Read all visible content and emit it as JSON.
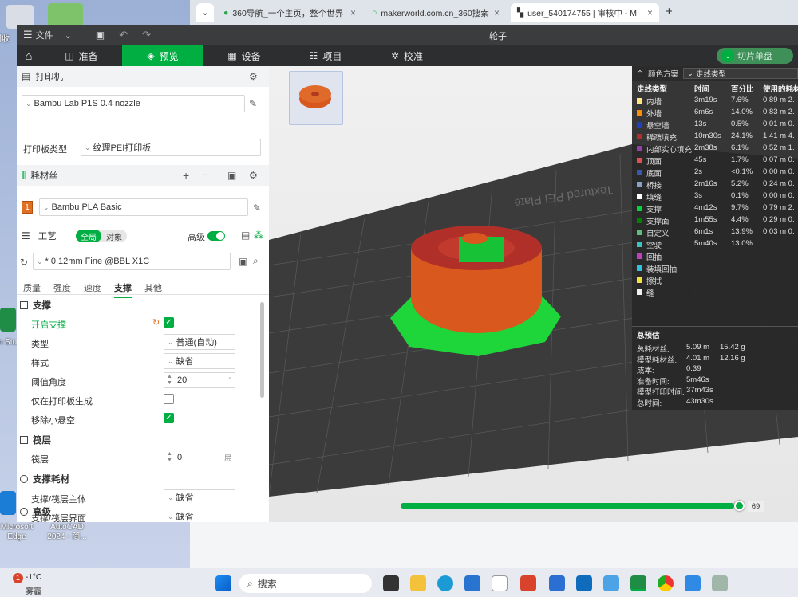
{
  "colors": {
    "accent": "#00ae42",
    "titlebar": "#3a3c3d",
    "tabbar": "#2c2e2f"
  },
  "desktop": {
    "icons": [
      {
        "label": "回收",
        "name": "recycle-bin-icon"
      },
      {
        "label": "Bam Stu",
        "name": "bambu-studio-icon"
      },
      {
        "label": "Microsoft Edge",
        "name": "edge-icon"
      },
      {
        "label": "AutoCAD 2024 - 简...",
        "name": "autocad-icon"
      }
    ]
  },
  "browser": {
    "tabs": [
      {
        "label": "360导航_一个主页，整个世界"
      },
      {
        "label": "makerworld.com.cn_360搜索"
      },
      {
        "label": "user_540174755 | 审核中 - M"
      }
    ],
    "new_tab": "+"
  },
  "app": {
    "menu_label": "文件",
    "window_title": "轮子",
    "tabs": [
      {
        "label": "准备"
      },
      {
        "label": "预览"
      },
      {
        "label": "设备"
      },
      {
        "label": "项目"
      },
      {
        "label": "校准"
      }
    ],
    "slice_button": "切片单盘"
  },
  "panel": {
    "printer": {
      "title": "打印机",
      "printer_name": "Bambu Lab P1S 0.4 nozzle",
      "plate_label": "打印板类型",
      "plate_value": "纹理PEI打印板"
    },
    "filament": {
      "title": "耗材丝",
      "index": "1",
      "name": "Bambu PLA Basic"
    },
    "process": {
      "title": "工艺",
      "scope_global": "全局",
      "scope_object": "对象",
      "advanced_label": "高级",
      "preset": "* 0.12mm Fine @BBL X1C",
      "sub_tabs": [
        "质量",
        "强度",
        "速度",
        "支撑",
        "其他"
      ]
    },
    "support": {
      "title": "支撑",
      "enable_label": "开启支撑",
      "enable_checked": true,
      "type_label": "类型",
      "type_value": "普通(自动)",
      "style_label": "样式",
      "style_value": "缺省",
      "threshold_label": "阈值角度",
      "threshold_value": "20",
      "threshold_unit": "°",
      "only_plate_label": "仅在打印板生成",
      "only_plate_checked": false,
      "remove_small_label": "移除小悬空",
      "remove_small_checked": true
    },
    "raft": {
      "title": "筏层",
      "layers_label": "筏层",
      "layers_value": "0",
      "layers_unit": "层"
    },
    "support_filament": {
      "title": "支撑耗材",
      "base_label": "支撑/筏层主体",
      "base_value": "缺省",
      "interface_label": "支撑/筏层界面",
      "interface_value": "缺省"
    },
    "advanced": {
      "title": "高级"
    }
  },
  "viewport": {
    "plate_text": "Textured PEI Plate"
  },
  "legend": {
    "title": "颜色方案",
    "scheme": "走线类型",
    "columns": [
      "走线类型",
      "时间",
      "百分比",
      "使用的耗材"
    ],
    "rows": [
      {
        "name": "内墙",
        "time": "3m19s",
        "pct": "7.6%",
        "usage": "0.89 m 2.",
        "color": "#ffe680"
      },
      {
        "name": "外墙",
        "time": "6m6s",
        "pct": "14.0%",
        "usage": "0.83 m 2.",
        "color": "#ff8c00"
      },
      {
        "name": "悬空墙",
        "time": "13s",
        "pct": "0.5%",
        "usage": "0.01 m 0.",
        "color": "#1f3fbf"
      },
      {
        "name": "稀疏填充",
        "time": "10m30s",
        "pct": "24.1%",
        "usage": "1.41 m 4.",
        "color": "#b03029"
      },
      {
        "name": "内部实心填充",
        "time": "2m38s",
        "pct": "6.1%",
        "usage": "0.52 m 1.",
        "color": "#9440a8"
      },
      {
        "name": "顶面",
        "time": "45s",
        "pct": "1.7%",
        "usage": "0.07 m 0.",
        "color": "#e05050"
      },
      {
        "name": "底面",
        "time": "2s",
        "pct": "<0.1%",
        "usage": "0.00 m 0.",
        "color": "#3858b0"
      },
      {
        "name": "桥接",
        "time": "2m16s",
        "pct": "5.2%",
        "usage": "0.24 m 0.",
        "color": "#8aa0c8"
      },
      {
        "name": "填缝",
        "time": "3s",
        "pct": "0.1%",
        "usage": "0.00 m 0.",
        "color": "#ffffff"
      },
      {
        "name": "支撑",
        "time": "4m12s",
        "pct": "9.7%",
        "usage": "0.79 m 2.",
        "color": "#00d43a"
      },
      {
        "name": "支撑面",
        "time": "1m55s",
        "pct": "4.4%",
        "usage": "0.29 m 0.",
        "color": "#008000"
      },
      {
        "name": "自定义",
        "time": "6m1s",
        "pct": "13.9%",
        "usage": "0.03 m 0.",
        "color": "#5ebd78"
      },
      {
        "name": "空驶",
        "time": "5m40s",
        "pct": "13.0%",
        "usage": "",
        "color": "#40c0c0"
      },
      {
        "name": "回抽",
        "time": "",
        "pct": "",
        "usage": "",
        "color": "#c040c0"
      },
      {
        "name": "装填回抽",
        "time": "",
        "pct": "",
        "usage": "",
        "color": "#30c0e0"
      },
      {
        "name": "擦拭",
        "time": "",
        "pct": "",
        "usage": "",
        "color": "#f0e040"
      },
      {
        "name": "缝",
        "time": "",
        "pct": "",
        "usage": "",
        "color": "#f0f0f0"
      }
    ],
    "totals_title": "总预估",
    "totals": [
      {
        "label": "总耗材丝:",
        "value": "5.09 m",
        "extra": "15.42 g"
      },
      {
        "label": "模型耗材丝:",
        "value": "4.01 m",
        "extra": "12.16 g"
      },
      {
        "label": "成本:",
        "value": "0.39",
        "extra": ""
      },
      {
        "label": "准备时间:",
        "value": "5m46s",
        "extra": ""
      },
      {
        "label": "模型打印时间:",
        "value": "37m43s",
        "extra": ""
      },
      {
        "label": "总时间:",
        "value": "43m30s",
        "extra": ""
      }
    ]
  },
  "layer_slider": {
    "value": "69",
    "fraction": 0.98
  },
  "taskbar": {
    "weather_temp": "-1°C",
    "weather_desc": "雾霾",
    "weather_badge": "1",
    "search_placeholder": "搜索"
  }
}
